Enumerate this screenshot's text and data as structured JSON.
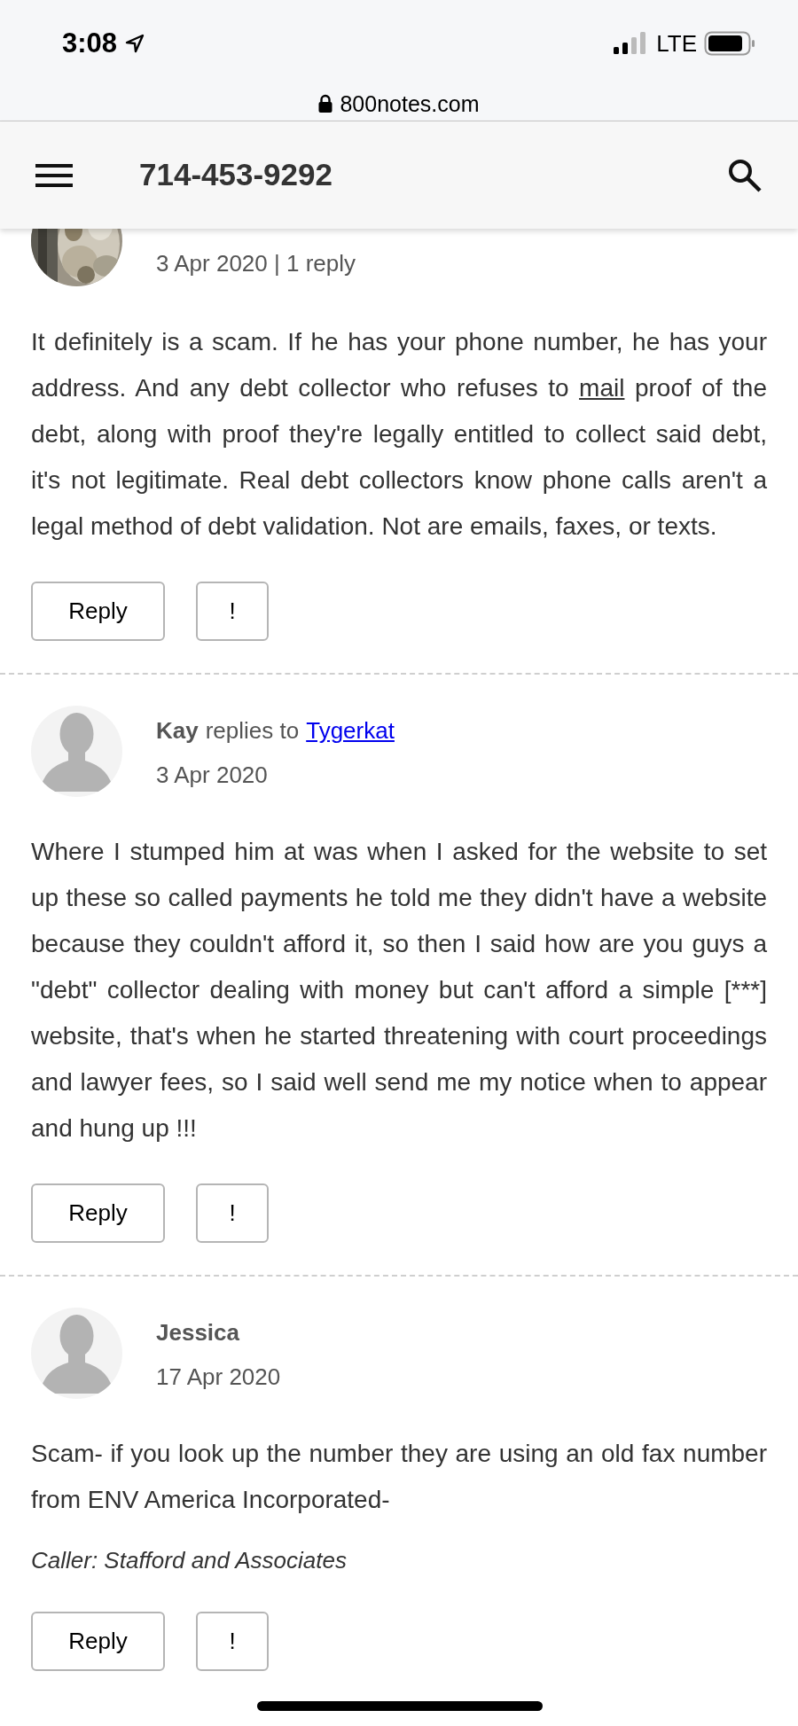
{
  "status_bar": {
    "time": "3:08",
    "network": "LTE"
  },
  "address_bar": {
    "url": "800notes.com"
  },
  "header": {
    "title": "714-453-9292"
  },
  "posts": [
    {
      "avatar": {
        "kind": "picture"
      },
      "meta": "3 Apr 2020 | 1 reply",
      "body": [
        {
          "text": "It definitely is a scam. If he has your phone number, he has your address. And any debt collector who refuses to "
        },
        {
          "text": "mail",
          "link": true
        },
        {
          "text": " proof of the debt, along with proof they're legally entitled to collect said debt, it's not legitimate. Real debt collectors know phone calls aren't a legal method of debt validation. Not are emails, faxes, or texts."
        }
      ],
      "buttons": [
        "Reply",
        "!"
      ]
    },
    {
      "avatar": {
        "kind": "placeholder"
      },
      "author": "Kay",
      "replies_label": "replies to",
      "reply_to": "Tygerkat",
      "meta": "3 Apr 2020",
      "body": [
        {
          "text": "Where I stumped him at was when I asked for the website to set up these so called payments he told me they didn't have a website because they couldn't afford it, so then I said how are you guys a \"debt\" collector dealing with money but can't afford a simple [***] website, that's when he started threatening with court proceedings and lawyer fees, so I said well send me my notice when to appear and hung up !!!"
        }
      ],
      "buttons": [
        "Reply",
        "!"
      ]
    },
    {
      "avatar": {
        "kind": "placeholder"
      },
      "author": "Jessica",
      "meta": "17 Apr 2020",
      "body": [
        {
          "text": "Scam- if you look up the number they are using an old fax number from ENV America Incorporated-"
        }
      ],
      "caller": "Caller: Stafford and Associates",
      "buttons": [
        "Reply",
        "!"
      ]
    }
  ]
}
